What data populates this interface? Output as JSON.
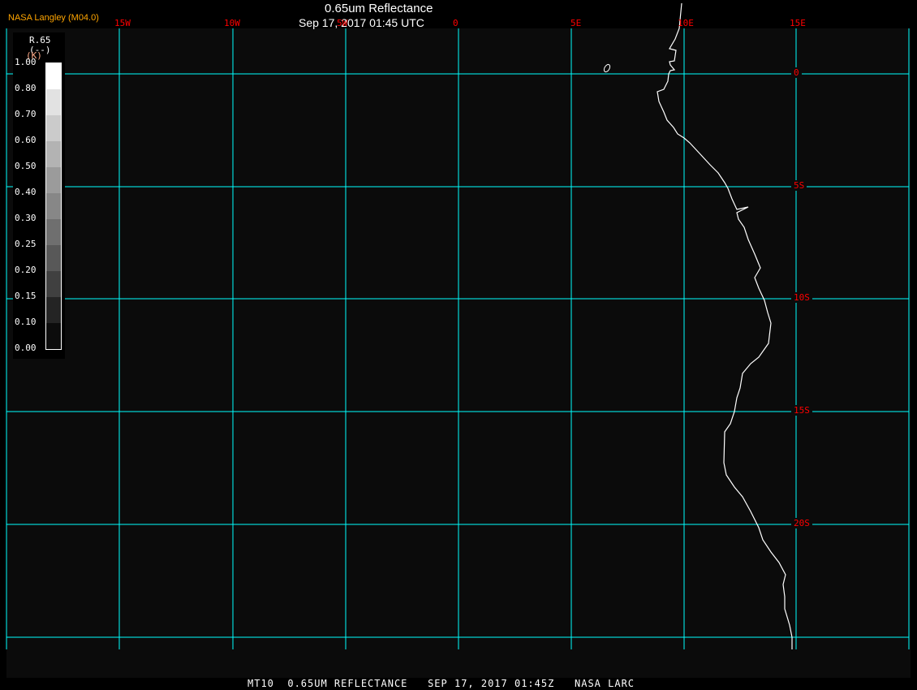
{
  "header": {
    "title": "0.65um Reflectance",
    "datetime": "Sep 17, 2017 01:45 UTC",
    "brand": "NASA Langley (M04.0)"
  },
  "longitude_labels": [
    "15W",
    "10W",
    "5W",
    "0",
    "5E",
    "10E",
    "15E"
  ],
  "latitude_labels": [
    "0",
    "5S",
    "10S",
    "15S",
    "20S"
  ],
  "legend": {
    "title": "R.65",
    "units": "(--)",
    "unit_k": "(K)",
    "ticks": [
      "1.00",
      "0.80",
      "0.70",
      "0.60",
      "0.50",
      "0.40",
      "0.30",
      "0.25",
      "0.20",
      "0.15",
      "0.10",
      "0.00"
    ],
    "colors": [
      "#ffffff",
      "#e2e2e2",
      "#cbcbcb",
      "#b3b3b3",
      "#9b9b9b",
      "#878787",
      "#6f6f6f",
      "#585858",
      "#404040",
      "#242424",
      "#0c0c0c"
    ]
  },
  "footer": "MT10  0.65UM REFLECTANCE   SEP 17, 2017 01:45Z   NASA LARC",
  "colors": {
    "grid": "#00ffff",
    "labels": "#ff0000",
    "coast": "#ffffff",
    "background": "#0b0b0b"
  }
}
